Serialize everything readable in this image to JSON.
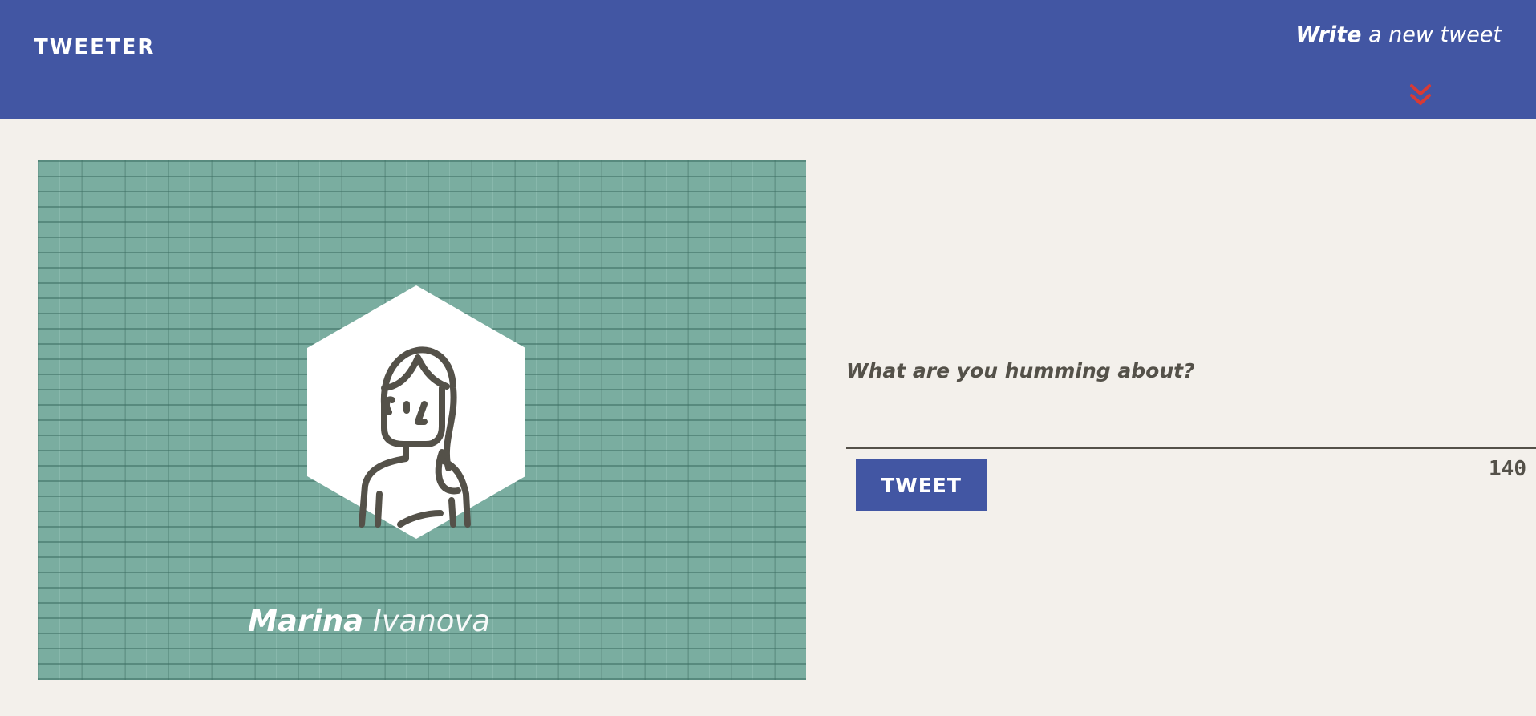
{
  "navbar": {
    "brand": "TWEETER",
    "compose_toggle": {
      "emphasis": "Write",
      "rest": " a new tweet"
    },
    "chevron_icon": "double-chevron-down-icon",
    "background": "#4256a3",
    "chevron_color": "#d83a34"
  },
  "profile": {
    "first_name": "Marina",
    "last_name": " Ivanova",
    "avatar_icon": "woman-avatar-icon",
    "card_color": "#7aada0"
  },
  "composer": {
    "placeholder": "What are you humming about?",
    "value": "",
    "button_label": "TWEET",
    "char_count": "140"
  }
}
